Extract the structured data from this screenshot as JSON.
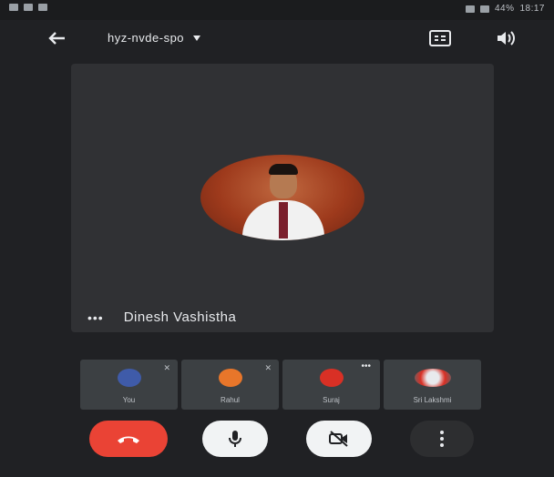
{
  "status_bar": {
    "left_text": "",
    "right_text": "18:17",
    "battery": "44%"
  },
  "topbar": {
    "meeting_code": "hyz-nvde-spo",
    "back_icon": "arrow-left-icon",
    "captions_icon": "captions-icon",
    "speaker_icon": "speaker-icon"
  },
  "main": {
    "participant_name": "Dinesh Vashistha",
    "more_icon": "more-horizontal-icon"
  },
  "thumbnails": [
    {
      "label": "You",
      "avatar_color": "#3f5ba9"
    },
    {
      "label": "Rahul",
      "avatar_color": "#e8762a"
    },
    {
      "label": "Suraj",
      "avatar_color": "#d93025"
    },
    {
      "label": "Sri Lakshmi",
      "avatar_color": "#5f6368"
    }
  ],
  "controls": {
    "end_call_icon": "call-end-icon",
    "mic_icon": "mic-icon",
    "camera_icon": "camera-off-icon",
    "more_icon": "more-vertical-icon"
  },
  "colors": {
    "background": "#202124",
    "tile": "#303134",
    "end_call": "#ea4335",
    "control_light": "#f1f3f4"
  }
}
